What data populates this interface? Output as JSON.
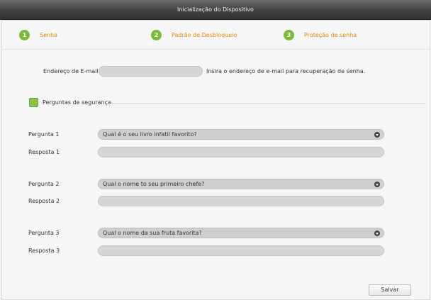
{
  "window": {
    "title": "Inicialização do Dispositivo"
  },
  "steps": [
    {
      "number": "1",
      "label": "Senha"
    },
    {
      "number": "2",
      "label": "Padrão de Desbloqueio"
    },
    {
      "number": "3",
      "label": "Proteção de senha"
    }
  ],
  "email": {
    "label": "Endereço de E-mail",
    "value": "",
    "hint": "Insira o endereço de  e-mail para recuperação de senha."
  },
  "security": {
    "label": "Perguntas de segurança",
    "checked": true
  },
  "questions": [
    {
      "question_label": "Pergunta 1",
      "question_value": "Qual é o seu livro infatil favorito?",
      "answer_label": "Resposta 1",
      "answer_value": ""
    },
    {
      "question_label": "Pergunta 2",
      "question_value": "Qual o nome to seu primeiro chefe?",
      "answer_label": "Resposta 2",
      "answer_value": ""
    },
    {
      "question_label": "Pergunta 3",
      "question_value": "Qual o nome da sua fruta favorita?",
      "answer_label": "Resposta 3",
      "answer_value": ""
    }
  ],
  "buttons": {
    "save": "Salvar"
  },
  "colors": {
    "accent_green": "#7cba3c",
    "step_label": "#e38a14",
    "titlebar": "#3e3e3e"
  }
}
